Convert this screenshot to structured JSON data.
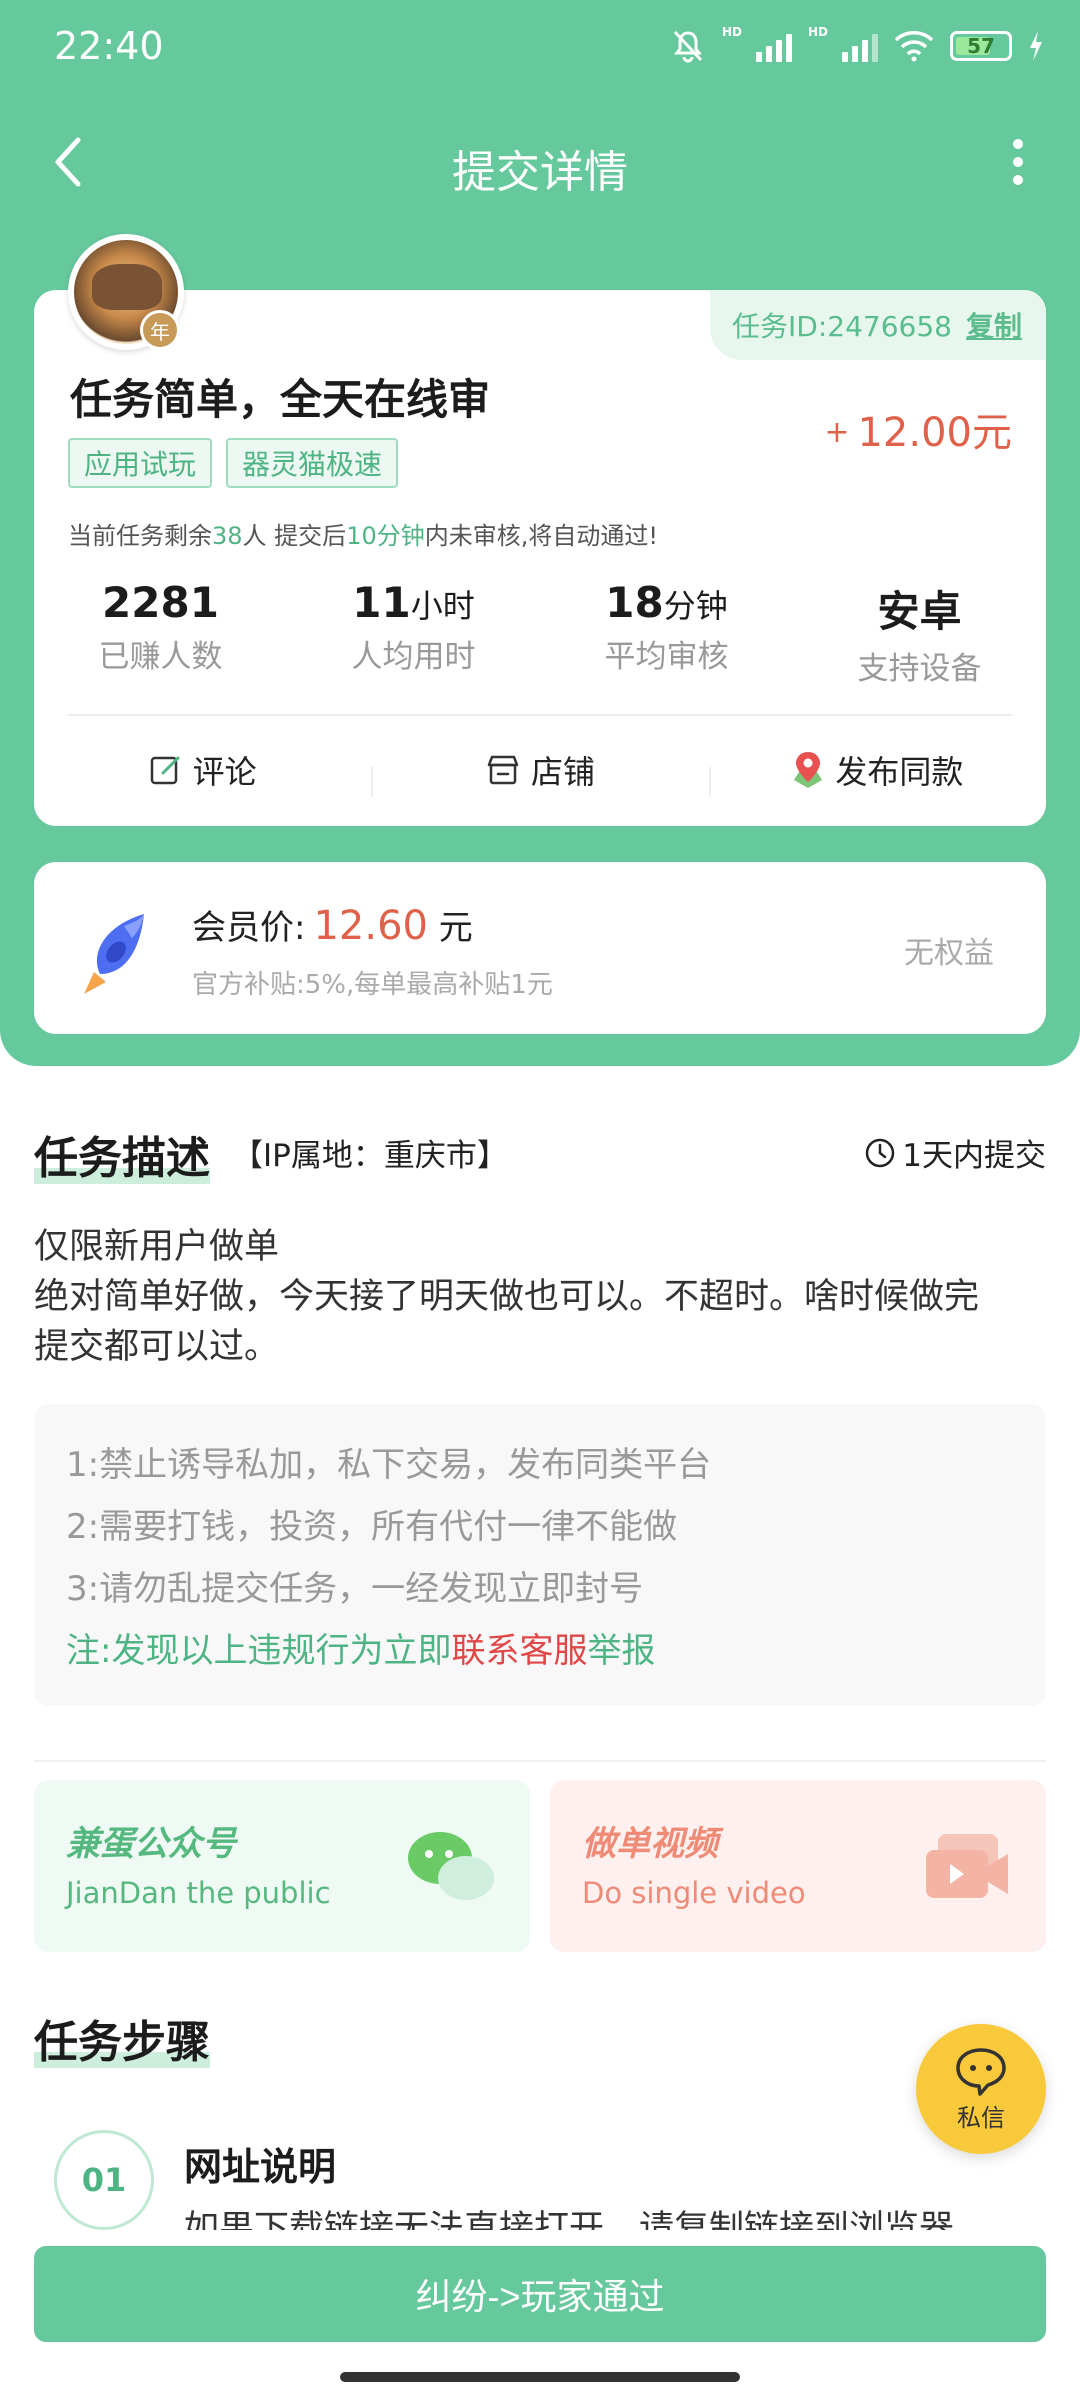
{
  "status_bar": {
    "time": "22:40",
    "battery": "57",
    "hd1": "HD",
    "hd2": "HD"
  },
  "nav": {
    "title": "提交详情"
  },
  "task": {
    "id_label": "任务ID:2476658",
    "copy_label": "复制",
    "title": "任务简单，全天在线审",
    "price_plus": "+",
    "price": "12.00元",
    "tags": [
      "应用试玩",
      "器灵猫极速"
    ],
    "notice": {
      "p1": "当前任务剩余",
      "remaining": "38",
      "p2": "人  提交后",
      "minutes": "10分钟",
      "p3": "内未审核,将自动通过!"
    },
    "stats": [
      {
        "value": "2281",
        "unit": "",
        "label": "已赚人数"
      },
      {
        "value": "11",
        "unit": "小时",
        "label": "人均用时"
      },
      {
        "value": "18",
        "unit": "分钟",
        "label": "平均审核"
      },
      {
        "value": "安卓",
        "unit": "",
        "label": "支持设备"
      }
    ],
    "actions": {
      "comment": "评论",
      "shop": "店铺",
      "publish": "发布同款"
    },
    "avatar_badge": "年"
  },
  "vip": {
    "label": "会员价:",
    "price": "12.60",
    "unit": "元",
    "subtitle": "官方补贴:5%,每单最高补贴1元",
    "right": "无权益"
  },
  "description": {
    "title": "任务描述",
    "ip": "【IP属地：重庆市】",
    "deadline": "1天内提交",
    "lines": [
      "仅限新用户做单",
      "绝对简单好做，今天接了明天做也可以。不超时。啥时候做完",
      "提交都可以过。"
    ],
    "rules": [
      "1:禁止诱导私加，私下交易，发布同类平台",
      "2:需要打钱，投资，所有代付一律不能做",
      "3:请勿乱提交任务，一经发现立即封号"
    ],
    "note_p1": "注:发现以上违规行为立即",
    "note_red": "联系客服",
    "note_p2": "举报"
  },
  "promos": {
    "wechat_title": "兼蛋公众号",
    "wechat_sub": "JianDan the public",
    "video_title": "做单视频",
    "video_sub": "Do single video"
  },
  "steps": {
    "title": "任务步骤",
    "items": [
      {
        "num": "01",
        "heading": "网址说明",
        "body": "如果下载链接无法直接打开，请复制链接到浏览器"
      }
    ]
  },
  "chat": {
    "label": "私信"
  },
  "bottom_button": {
    "label": "纠纷->玩家通过"
  },
  "colors": {
    "primary": "#66c99d",
    "price": "#e0614a",
    "danger": "#e04848"
  }
}
